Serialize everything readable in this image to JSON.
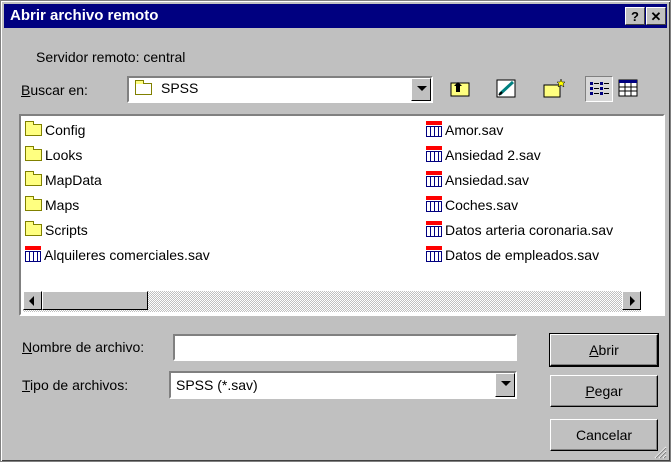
{
  "dialog": {
    "title": "Abrir archivo remoto",
    "help_label": "?",
    "close_label": "✕",
    "server_label": "Servidor remoto: central"
  },
  "lookin": {
    "label_first": "B",
    "label_rest": "uscar en:",
    "value": "SPSS"
  },
  "files": {
    "col1": [
      {
        "name": "Config",
        "icon": "folder-icon"
      },
      {
        "name": "Looks",
        "icon": "folder-icon"
      },
      {
        "name": "MapData",
        "icon": "folder-icon"
      },
      {
        "name": "Maps",
        "icon": "folder-icon"
      },
      {
        "name": "Scripts",
        "icon": "folder-icon"
      },
      {
        "name": "Alquileres comerciales.sav",
        "icon": "sav-file-icon"
      }
    ],
    "col2": [
      {
        "name": "Amor.sav",
        "icon": "sav-file-icon"
      },
      {
        "name": "Ansiedad 2.sav",
        "icon": "sav-file-icon"
      },
      {
        "name": "Ansiedad.sav",
        "icon": "sav-file-icon"
      },
      {
        "name": "Coches.sav",
        "icon": "sav-file-icon"
      },
      {
        "name": "Datos arteria coronaria.sav",
        "icon": "sav-file-icon"
      },
      {
        "name": "Datos de empleados.sav",
        "icon": "sav-file-icon"
      }
    ]
  },
  "filename": {
    "label_first": "N",
    "label_rest": "ombre de archivo:",
    "value": ""
  },
  "filetype": {
    "label_first": "T",
    "label_rest": "ipo de archivos:",
    "value": "SPSS (*.sav)"
  },
  "buttons": {
    "open_first": "A",
    "open_rest": "brir",
    "paste_first": "P",
    "paste_rest": "egar",
    "cancel": "Cancelar"
  }
}
